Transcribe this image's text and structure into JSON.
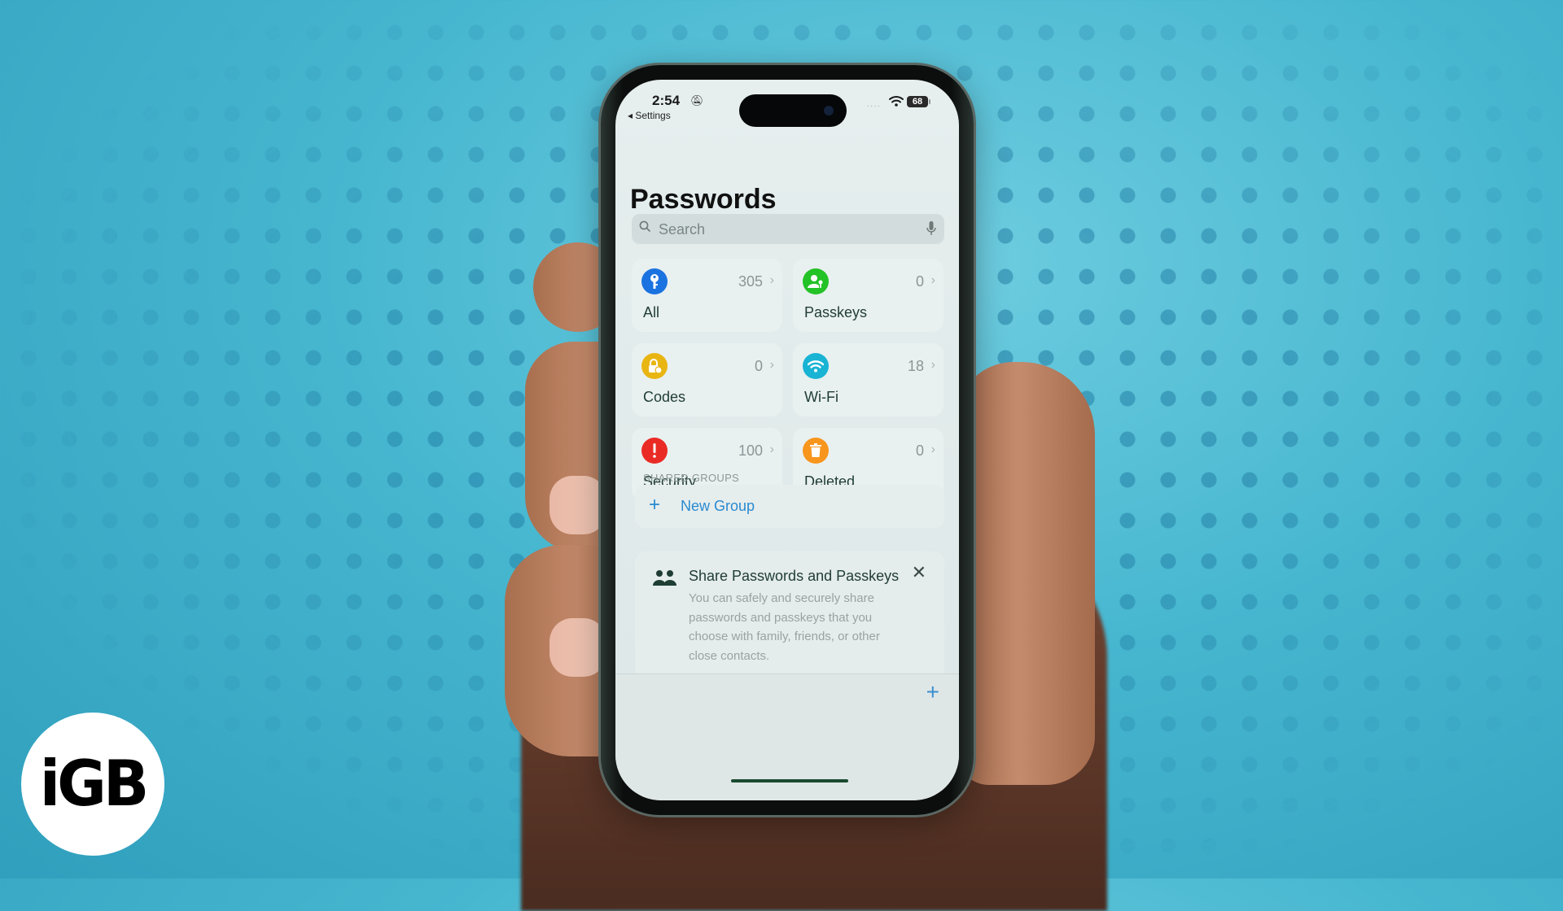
{
  "background": {
    "color": "#47b7d0"
  },
  "watermark": {
    "text": "iGB"
  },
  "status_bar": {
    "time": "2:54",
    "back_label": "◂ Settings",
    "silent_icon": "bell-slash-icon",
    "battery": "68"
  },
  "app": {
    "title": "Passwords",
    "search": {
      "placeholder": "Search"
    },
    "categories": [
      {
        "label": "All",
        "count": "305",
        "icon": "key-icon",
        "color": "#1a73e0"
      },
      {
        "label": "Passkeys",
        "count": "0",
        "icon": "person-key-icon",
        "color": "#23c226"
      },
      {
        "label": "Codes",
        "count": "0",
        "icon": "lock-clock-icon",
        "color": "#e9b513"
      },
      {
        "label": "Wi-Fi",
        "count": "18",
        "icon": "wifi-icon",
        "color": "#19b3d4"
      },
      {
        "label": "Security",
        "count": "100",
        "icon": "exclamation-icon",
        "color": "#ea2b25"
      },
      {
        "label": "Deleted",
        "count": "0",
        "icon": "trash-icon",
        "color": "#f7951d"
      }
    ],
    "chevron": "›",
    "shared_groups": {
      "header": "SHARED GROUPS",
      "new_group_label": "New Group"
    },
    "share_card": {
      "title": "Share Passwords and Passkeys",
      "body": "You can safely and securely share passwords and passkeys that you choose with family, friends, or other close contacts."
    },
    "toolbar": {
      "add_label": "+"
    }
  }
}
